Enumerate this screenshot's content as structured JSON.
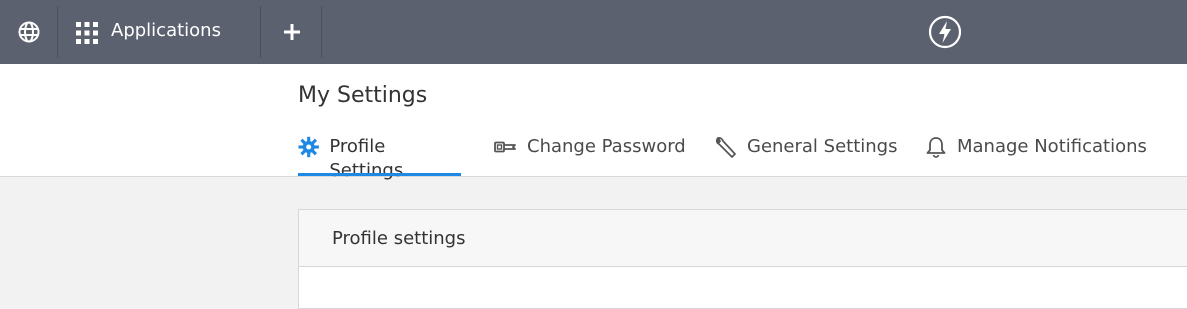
{
  "topbar": {
    "globe_icon": "globe-icon",
    "apps_icon": "apps-grid-icon",
    "apps_label": "Applications",
    "add_icon": "plus-icon",
    "logo_icon": "lightning-bolt-icon",
    "bg_color": "#5b616e"
  },
  "page": {
    "title": "My Settings"
  },
  "tabs": [
    {
      "label": "Profile Settings",
      "icon": "gear-icon",
      "active": true
    },
    {
      "label": "Change Password",
      "icon": "key-icon",
      "active": false
    },
    {
      "label": "General Settings",
      "icon": "wrench-icon",
      "active": false
    },
    {
      "label": "Manage Notifications",
      "icon": "bell-icon",
      "active": false
    }
  ],
  "panel": {
    "title": "Profile settings"
  },
  "colors": {
    "accent": "#1e88e5"
  }
}
